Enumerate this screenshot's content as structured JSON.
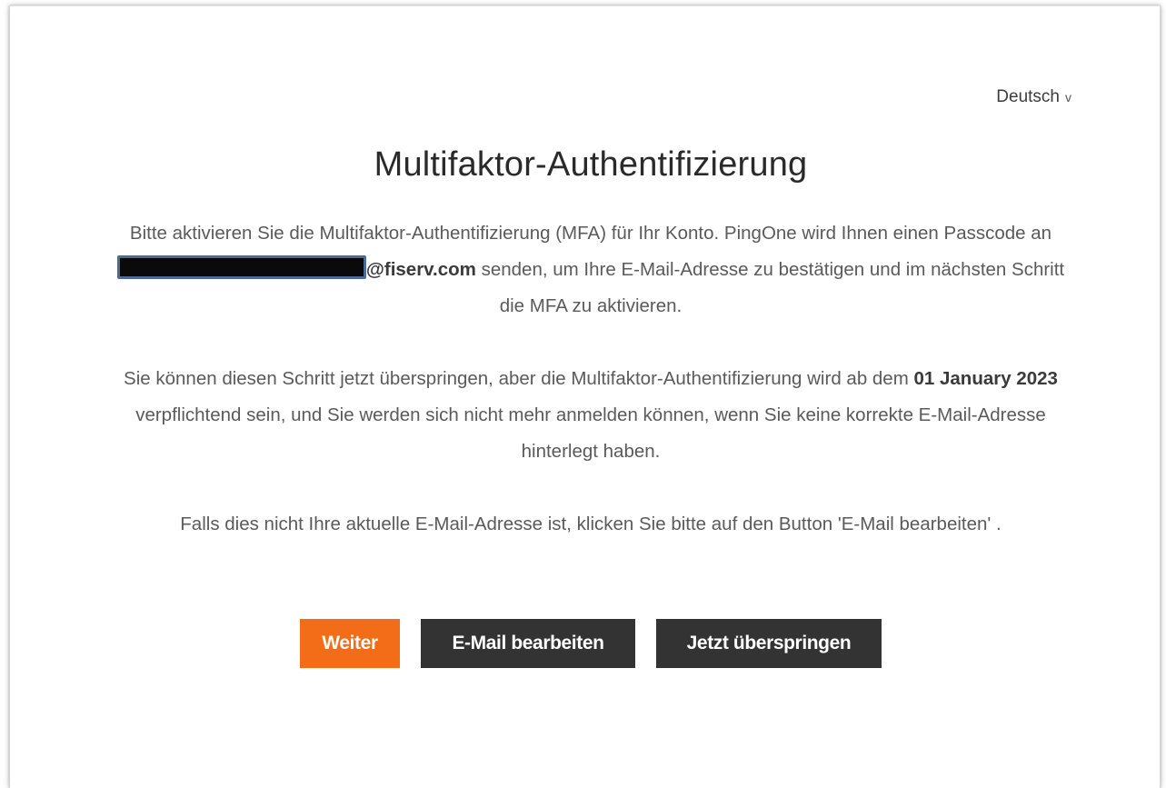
{
  "header": {
    "language_label": "Deutsch",
    "language_chevron": "v"
  },
  "main": {
    "title": "Multifaktor-Authentifizierung",
    "para1_part1": "Bitte aktivieren Sie die Multifaktor-Authentifizierung (MFA) für Ihr Konto. PingOne wird Ihnen einen Passcode an ",
    "email_domain": "@fiserv.com",
    "para1_part2": " senden, um Ihre E-Mail-Adresse zu bestätigen und im nächsten Schritt die MFA zu aktivieren.",
    "para2_part1": "Sie können diesen Schritt jetzt überspringen, aber die Multifaktor-Authentifizierung wird ab dem ",
    "deadline_date": "01 January 2023",
    "para2_part2": " verpflichtend sein, und Sie werden sich nicht mehr anmelden können, wenn Sie keine korrekte E-Mail-Adresse hinterlegt haben.",
    "para3": "Falls dies nicht Ihre aktuelle E-Mail-Adresse ist, klicken Sie bitte auf den Button 'E-Mail bearbeiten' ."
  },
  "buttons": {
    "continue_label": "Weiter",
    "edit_email_label": "E-Mail bearbeiten",
    "skip_label": "Jetzt überspringen"
  },
  "colors": {
    "primary_button": "#f36c17",
    "secondary_button": "#333333",
    "redaction_box": "#0a0a0a"
  }
}
